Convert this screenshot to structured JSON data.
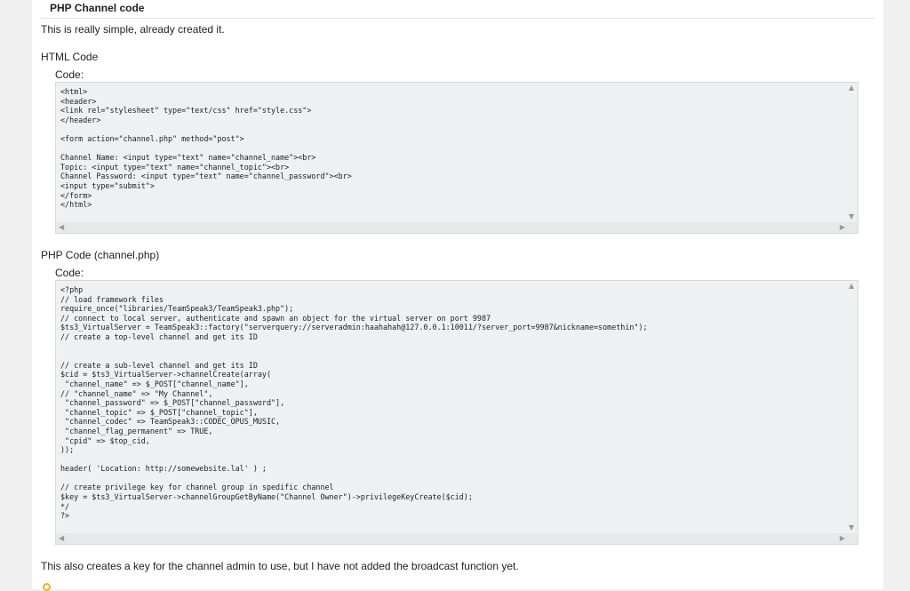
{
  "post": {
    "title": "PHP Channel code",
    "intro": "This is really simple, already created it.",
    "outro": "This also creates a key for the channel admin to use, but I have not added the broadcast function yet."
  },
  "sections": [
    {
      "heading": "HTML Code",
      "code_label": "Code:",
      "code": "<html>\n<header>\n<link rel=\"stylesheet\" type=\"text/css\" href=\"style.css\">\n</header>\n\n<form action=\"channel.php\" method=\"post\">\n\nChannel Name: <input type=\"text\" name=\"channel_name\"><br>\nTopic: <input type=\"text\" name=\"channel_topic\"><br>\nChannel Password: <input type=\"text\" name=\"channel_password\"><br>\n<input type=\"submit\">\n</form>\n</html>"
    },
    {
      "heading": "PHP Code (channel.php)",
      "code_label": "Code:",
      "code": "<?php\n// load framework files\nrequire_once(\"libraries/TeamSpeak3/TeamSpeak3.php\");\n// connect to local server, authenticate and spawn an object for the virtual server on port 9987\n$ts3_VirtualServer = TeamSpeak3::factory(\"serverquery://serveradmin:haahahah@127.0.0.1:10011/?server_port=9987&nickname=somethin\");\n// create a top-level channel and get its ID\n\n\n// create a sub-level channel and get its ID\n$cid = $ts3_VirtualServer->channelCreate(array(\n \"channel_name\" => $_POST[\"channel_name\"],\n// \"channel_name\" => \"My Channel\",\n \"channel_password\" => $_POST[\"channel_password\"],\n \"channel_topic\" => $_POST[\"channel_topic\"],\n \"channel_codec\" => TeamSpeak3::CODEC_OPUS_MUSIC,\n \"channel_flag_permanent\" => TRUE,\n \"cpid\" => $top_cid,\n));\n\nheader( 'Location: http://somewebsite.lal' ) ;\n\n// create privilege key for channel group in spedific channel\n$key = $ts3_VirtualServer->channelGroupGetByName(\"Channel Owner\")->privilegeKeyCreate($cid);\n*/\n?>"
    }
  ],
  "icons": {
    "scroll_up": "▲",
    "scroll_down": "▼",
    "scroll_left": "◀",
    "scroll_right": "▶"
  }
}
